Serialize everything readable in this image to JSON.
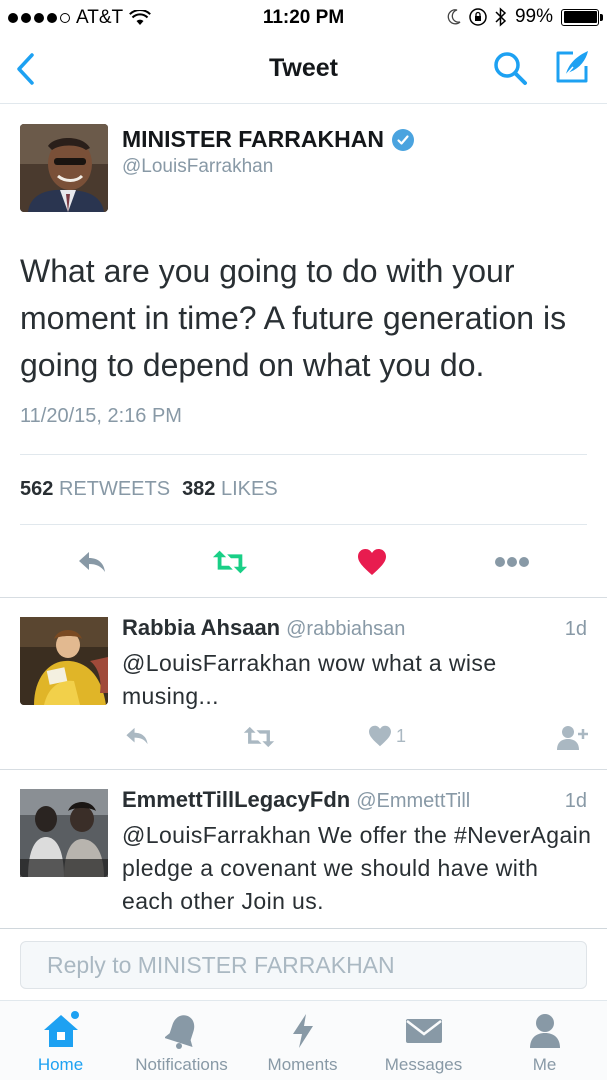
{
  "status_bar": {
    "carrier": "AT&T",
    "time": "11:20 PM",
    "battery": "99%",
    "battery_level": 0.99
  },
  "nav": {
    "title": "Tweet"
  },
  "tweet": {
    "author_name": "MINISTER FARRAKHAN",
    "author_handle": "@LouisFarrakhan",
    "text": "What are you going to do with your moment in time? A future generation is going to depend on what you do.",
    "timestamp": "11/20/15, 2:16 PM",
    "retweets_count": "562",
    "retweets_label": "RETWEETS",
    "likes_count": "382",
    "likes_label": "LIKES",
    "liked": true,
    "colors": {
      "retweet": "#19cf86",
      "like": "#e81c4f",
      "accent": "#1da1f2"
    }
  },
  "replies": [
    {
      "name": "Rabbia Ahsaan",
      "handle": "@rabbiahsan",
      "age": "1d",
      "text": "@LouisFarrakhan wow what a wise musing...",
      "like_count": "1"
    },
    {
      "name": "EmmettTillLegacyFdn",
      "handle": "@EmmettTill",
      "age": "1d",
      "text": "@LouisFarrakhan We offer the #NeverAgain pledge a covenant we should have with each other Join us."
    }
  ],
  "reply_box": {
    "placeholder": "Reply to MINISTER FARRAKHAN"
  },
  "tabs": [
    {
      "label": "Home",
      "icon": "home-icon",
      "active": true
    },
    {
      "label": "Notifications",
      "icon": "bell-icon"
    },
    {
      "label": "Moments",
      "icon": "lightning-icon"
    },
    {
      "label": "Messages",
      "icon": "envelope-icon"
    },
    {
      "label": "Me",
      "icon": "person-icon"
    }
  ]
}
